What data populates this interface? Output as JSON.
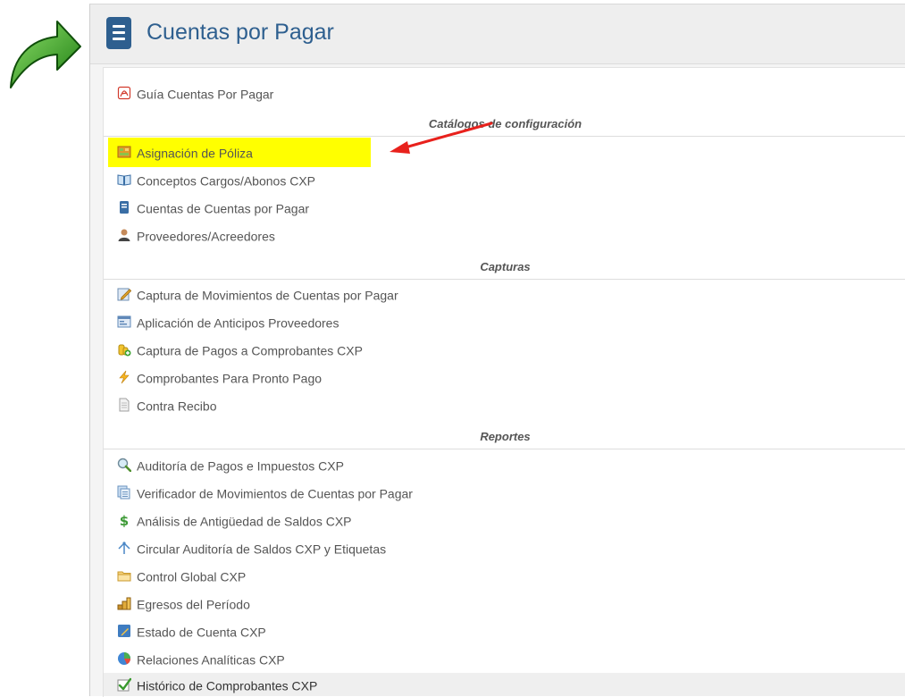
{
  "page": {
    "title": "Cuentas por Pagar"
  },
  "top_link": {
    "label": "Guía Cuentas Por Pagar",
    "icon": "pdf-icon"
  },
  "sections": [
    {
      "header": "Catálogos de configuración",
      "items": [
        {
          "label": "Asignación de Póliza",
          "icon": "policy-icon",
          "highlighted": true
        },
        {
          "label": "Conceptos Cargos/Abonos CXP",
          "icon": "open-book-icon"
        },
        {
          "label": "Cuentas de Cuentas por Pagar",
          "icon": "book-icon"
        },
        {
          "label": "Proveedores/Acreedores",
          "icon": "person-icon"
        }
      ]
    },
    {
      "header": "Capturas",
      "items": [
        {
          "label": "Captura de Movimientos de Cuentas por Pagar",
          "icon": "edit-icon"
        },
        {
          "label": "Aplicación de Anticipos Proveedores",
          "icon": "form-icon"
        },
        {
          "label": "Captura de Pagos a Comprobantes CXP",
          "icon": "coins-add-icon"
        },
        {
          "label": "Comprobantes Para Pronto Pago",
          "icon": "lightning-icon"
        },
        {
          "label": "Contra Recibo",
          "icon": "document-icon"
        }
      ]
    },
    {
      "header": "Reportes",
      "items": [
        {
          "label": "Auditoría de Pagos e Impuestos CXP",
          "icon": "magnifier-icon"
        },
        {
          "label": "Verificador de Movimientos de Cuentas por Pagar",
          "icon": "pages-icon"
        },
        {
          "label": "Análisis de Antigüedad de Saldos CXP",
          "icon": "dollar-icon"
        },
        {
          "label": "Circular Auditoría de Saldos CXP y Etiquetas",
          "icon": "branch-icon"
        },
        {
          "label": "Control Global CXP",
          "icon": "folder-icon"
        },
        {
          "label": "Egresos del Período",
          "icon": "coin-stack-icon"
        },
        {
          "label": "Estado de Cuenta CXP",
          "icon": "pencil-note-icon"
        },
        {
          "label": "Relaciones Analíticas CXP",
          "icon": "pie-chart-icon"
        },
        {
          "label": "Histórico de Comprobantes CXP",
          "icon": "check-icon",
          "selected": true
        }
      ]
    }
  ],
  "colors": {
    "brand": "#2e5f8f",
    "highlight": "#ffff00",
    "annotation_arrow": "#e8211c",
    "green_arrow": "#2e9e1f"
  }
}
